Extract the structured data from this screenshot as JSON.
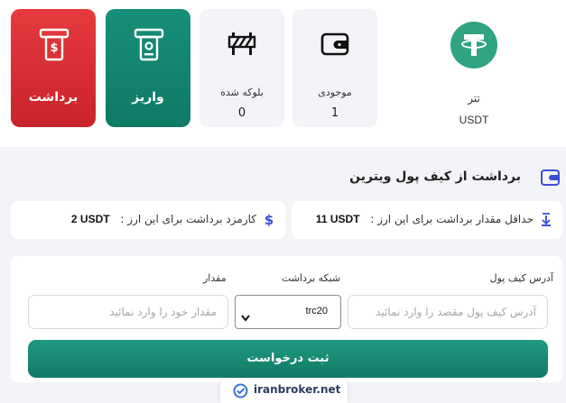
{
  "coin": {
    "name": "تتر",
    "symbol": "USDT",
    "icon": "tether-icon",
    "color": "#2fa382"
  },
  "stats": {
    "balance": {
      "label": "موجودی",
      "value": "1",
      "icon": "wallet-icon"
    },
    "blocked": {
      "label": "بلوکه شده",
      "value": "0",
      "icon": "barrier-icon"
    }
  },
  "actions": {
    "deposit": {
      "label": "واریز",
      "icon": "deposit-icon",
      "color": "#138470"
    },
    "withdraw": {
      "label": "برداشت",
      "icon": "withdraw-icon",
      "color": "#d92d33"
    }
  },
  "section": {
    "title": "برداشت از کیف پول ویترین",
    "icon": "wallet-icon"
  },
  "info": {
    "min_label": "حداقل مقدار برداشت برای این ارز :",
    "min_value": "11 USDT",
    "fee_label": "کارمزد برداشت برای این ارز :",
    "fee_value": "2 USDT"
  },
  "form": {
    "address_label": "آدرس کیف پول",
    "address_placeholder": "آدرس کیف پول مقصد را وارد نمائید",
    "network_label": "شبکه برداشت",
    "network_value": "trc20",
    "amount_label": "مقدار",
    "amount_placeholder": "مقدار خود را وارد نمائید",
    "submit_label": "ثبت درخواست"
  },
  "brand": {
    "text": "iranbroker.net"
  }
}
